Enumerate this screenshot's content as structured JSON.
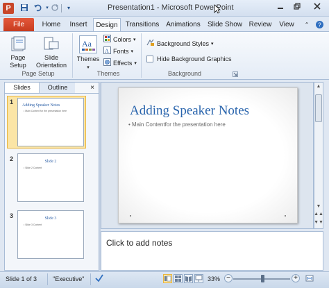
{
  "window": {
    "title": "Presentation1 - Microsoft PowerPoint",
    "app_icon_letter": "P"
  },
  "ribbon_tabs": {
    "file": "File",
    "home": "Home",
    "insert": "Insert",
    "design": "Design",
    "transitions": "Transitions",
    "animations": "Animations",
    "slide_show": "Slide Show",
    "review": "Review",
    "view": "View"
  },
  "ribbon": {
    "page_setup": {
      "page_setup_btn": "Page Setup",
      "slide_orientation_btn": "Slide Orientation",
      "group_label": "Page Setup"
    },
    "themes": {
      "themes_btn": "Themes",
      "colors": "Colors",
      "fonts": "Fonts",
      "effects": "Effects",
      "group_label": "Themes"
    },
    "background": {
      "background_styles": "Background Styles",
      "hide_background_graphics": "Hide Background Graphics",
      "hide_checked": false,
      "group_label": "Background"
    }
  },
  "left_pane": {
    "tabs": {
      "slides": "Slides",
      "outline": "Outline"
    },
    "close": "×",
    "thumbnails": [
      {
        "number": "1",
        "title": "Adding Speaker Notes",
        "body": "• Main Content for the presentation here",
        "selected": true
      },
      {
        "number": "2",
        "title": "Slide 2",
        "body": "• Slide 2 Content",
        "selected": false
      },
      {
        "number": "3",
        "title": "Slide 3",
        "body": "• Slide 3 Content",
        "selected": false
      }
    ]
  },
  "slide": {
    "title": "Adding Speaker Notes",
    "body": "• Main Contentfor the presentation here"
  },
  "notes": {
    "placeholder": "Click to add notes"
  },
  "status_bar": {
    "slide_info": "Slide 1 of 3",
    "theme": "\"Executive\"",
    "zoom": "33%",
    "zoom_out": "−",
    "zoom_in": "+"
  },
  "colors": {
    "file_tab": "#d0452a",
    "slide_title": "#2a65ad",
    "selection": "#fbe5a6"
  }
}
